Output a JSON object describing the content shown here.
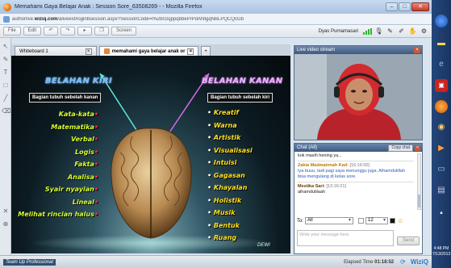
{
  "window": {
    "title": "Memahami Gaya Belajar Anak : Session Sore_63508269 - - Mozilla Firefox",
    "controls": [
      "–",
      "□",
      "✕"
    ]
  },
  "address": {
    "host": "authorlive.",
    "domain": "wiziq.com",
    "path": "/aliveext/loginbsession.aspx?SessionCode=l%2b02qppqbbePrPdANtgqNBLPQCQcGb"
  },
  "toolbar": {
    "file": "File",
    "edit": "Edit",
    "screen": "Screen",
    "user": "Dyas Purnamasari"
  },
  "tabs": [
    {
      "label": "Whiteboard 1",
      "active": false
    },
    {
      "label": "memahami gaya belajar anak or",
      "active": true
    }
  ],
  "whiteboard": {
    "left_heading": "BELAHAN KIRI",
    "right_heading": "BELAHAN KANAN",
    "left_sub": "Bagian tubuh sebelah kanan",
    "right_sub": "Bagian tubuh sebelah kiri",
    "left_items": [
      "Kata-kata",
      "Matematika",
      "Verbal",
      "Logis",
      "Fakta",
      "Analisa",
      "Syair nyayian",
      "Lineal",
      "Melihat rincian halus"
    ],
    "right_items": [
      "Kreatif",
      "Warna",
      "Artistik",
      "Visualisasi",
      "Intuisi",
      "Gagasan",
      "Khayalan",
      "Holistik",
      "Musik",
      "Bentuk",
      "Ruang"
    ],
    "signature": "DEWI"
  },
  "video": {
    "title": "Live video stream"
  },
  "chat": {
    "title": "Chat (All)",
    "copy_label": "Copy chat",
    "messages": [
      {
        "author": "",
        "time": "",
        "text": "kok masih hening ya..."
      },
      {
        "author": "Zakia Madmainnah Kad:",
        "time": "[16:16:00]",
        "text": "Iya buuu, tadi pagi saya menunggu juga. Alhamdulillah bisa mengulang di kelas sore."
      },
      {
        "author": "Mestika Sari:",
        "time": "[13:16:21]",
        "text": "alhamdulilaah"
      }
    ],
    "to_label": "To:",
    "to_value": "All",
    "font_size": "12",
    "input_placeholder": "Write your message here.",
    "send_label": "Send"
  },
  "status": {
    "brand": "Team Up Professional",
    "elapsed_label": "Elapsed Time",
    "elapsed_value": "01:18:52",
    "logo": "WiziQ"
  },
  "taskbar": {
    "time": "4:48 PM",
    "date": "7/13/2013"
  }
}
